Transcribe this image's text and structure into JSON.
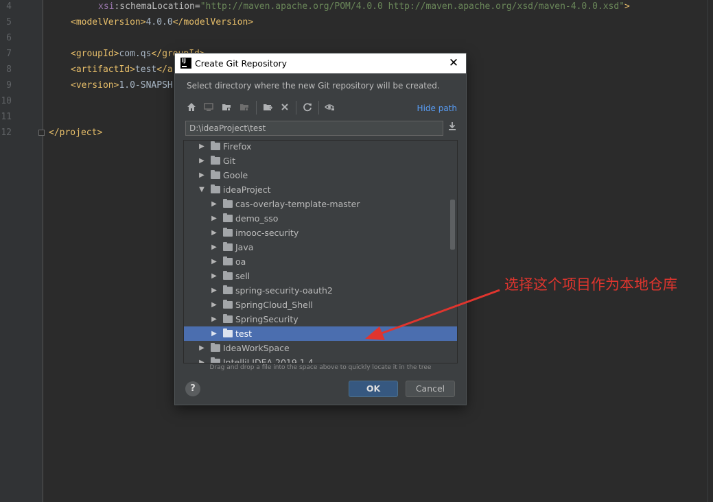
{
  "editor": {
    "lines": [
      {
        "no": "4",
        "parts": [
          {
            "t": "xsi",
            "c": "ns"
          },
          {
            "t": ":schemaLocation=",
            "c": "attr"
          },
          {
            "t": "\"http://maven.apache.org/POM/4.0.0 http://maven.apache.org/xsd/maven-4.0.0.xsd\"",
            "c": "str"
          },
          {
            "t": ">",
            "c": "tag"
          }
        ]
      },
      {
        "no": "5",
        "parts": [
          {
            "t": "<modelVersion>",
            "c": "tag"
          },
          {
            "t": "4.0.0",
            "c": "txt"
          },
          {
            "t": "</modelVersion>",
            "c": "tag"
          }
        ]
      },
      {
        "no": "6",
        "parts": []
      },
      {
        "no": "7",
        "parts": [
          {
            "t": "<groupId>",
            "c": "tag"
          },
          {
            "t": "com.qs",
            "c": "txt"
          },
          {
            "t": "</groupId>",
            "c": "tag"
          }
        ]
      },
      {
        "no": "8",
        "parts": [
          {
            "t": "<artifactId>",
            "c": "tag"
          },
          {
            "t": "test",
            "c": "txt"
          },
          {
            "t": "</a",
            "c": "tag"
          }
        ]
      },
      {
        "no": "9",
        "parts": [
          {
            "t": "<version>",
            "c": "tag"
          },
          {
            "t": "1.0-SNAPSH",
            "c": "txt"
          }
        ]
      },
      {
        "no": "10",
        "parts": []
      },
      {
        "no": "11",
        "parts": []
      },
      {
        "no": "12",
        "parts": [
          {
            "t": "</project>",
            "c": "tag"
          }
        ]
      }
    ]
  },
  "dialog": {
    "title": "Create Git Repository",
    "close_glyph": "✕",
    "description": "Select directory where the new Git repository will be created.",
    "toolbar": {
      "icons": [
        "home-icon",
        "desktop-icon",
        "project-folder-icon",
        "module-folder-icon",
        "new-folder-icon",
        "delete-icon",
        "refresh-icon",
        "show-hidden-icon"
      ],
      "hide_path_label": "Hide path"
    },
    "path_value": "D:\\ideaProject\\test",
    "tree": [
      {
        "label": "Firefox",
        "level": 1,
        "expanded": false,
        "selected": false
      },
      {
        "label": "Git",
        "level": 1,
        "expanded": false,
        "selected": false
      },
      {
        "label": "Goole",
        "level": 1,
        "expanded": false,
        "selected": false
      },
      {
        "label": "ideaProject",
        "level": 1,
        "expanded": true,
        "selected": false
      },
      {
        "label": "cas-overlay-template-master",
        "level": 2,
        "expanded": false,
        "selected": false
      },
      {
        "label": "demo_sso",
        "level": 2,
        "expanded": false,
        "selected": false
      },
      {
        "label": "imooc-security",
        "level": 2,
        "expanded": false,
        "selected": false
      },
      {
        "label": "Java",
        "level": 2,
        "expanded": false,
        "selected": false
      },
      {
        "label": "oa",
        "level": 2,
        "expanded": false,
        "selected": false
      },
      {
        "label": "sell",
        "level": 2,
        "expanded": false,
        "selected": false
      },
      {
        "label": "spring-security-oauth2",
        "level": 2,
        "expanded": false,
        "selected": false
      },
      {
        "label": "SpringCloud_Shell",
        "level": 2,
        "expanded": false,
        "selected": false
      },
      {
        "label": "SpringSecurity",
        "level": 2,
        "expanded": false,
        "selected": false
      },
      {
        "label": "test",
        "level": 2,
        "expanded": false,
        "selected": true
      },
      {
        "label": "IdeaWorkSpace",
        "level": 1,
        "expanded": false,
        "selected": false
      },
      {
        "label": "IntelliJ IDEA 2019.1.4",
        "level": 1,
        "expanded": false,
        "selected": false
      }
    ],
    "hint": "Drag and drop a file into the space above to quickly locate it in the tree",
    "help_label": "?",
    "ok_label": "OK",
    "cancel_label": "Cancel"
  },
  "annotation": {
    "text": "选择这个项目作为本地仓库",
    "color": "#e0352e"
  }
}
